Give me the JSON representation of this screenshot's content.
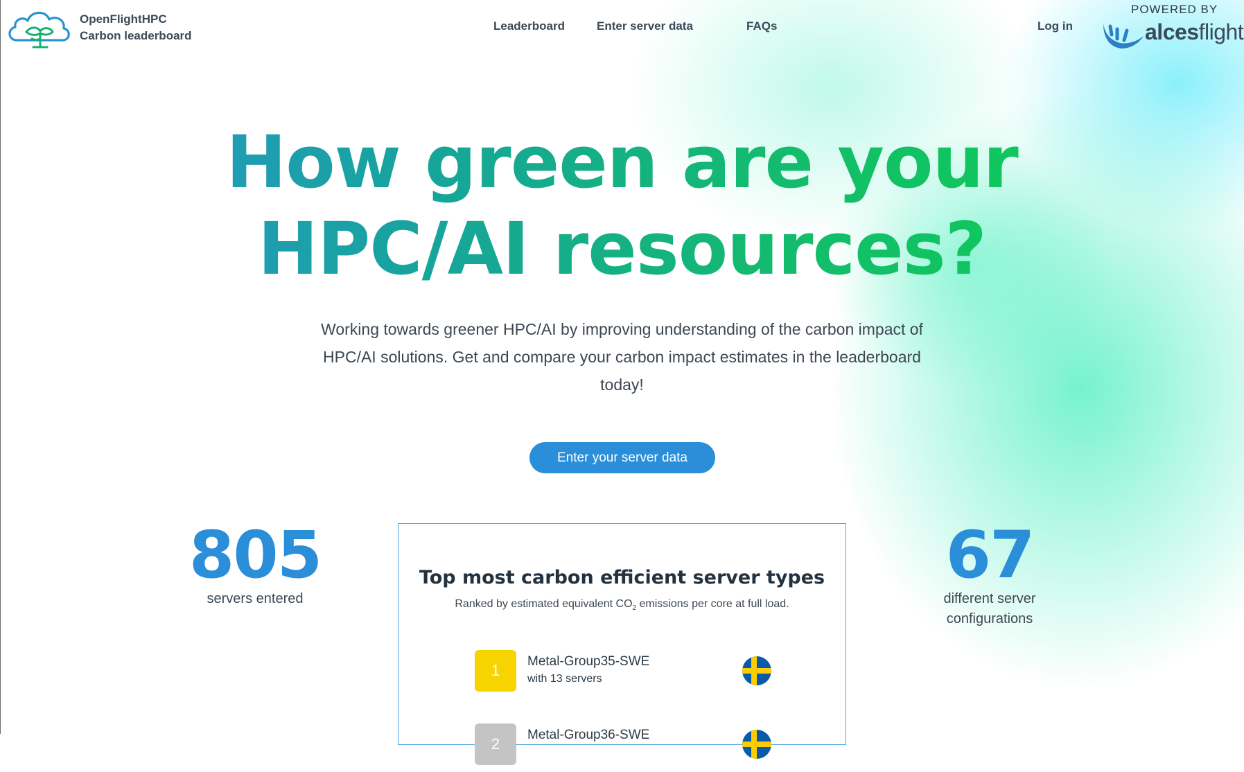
{
  "header": {
    "brand_line1": "OpenFlightHPC",
    "brand_line2": "Carbon leaderboard",
    "nav": [
      {
        "label": "Leaderboard"
      },
      {
        "label": "Enter server data"
      },
      {
        "label": "FAQs"
      }
    ],
    "login_label": "Log in",
    "powered_by": "POWERED BY",
    "partner_logo_bold": "alces",
    "partner_logo_light": "flight"
  },
  "hero": {
    "headline_line1": "How green are your",
    "headline_line2": "HPC/AI resources?",
    "intro": "Working towards greener HPC/AI by improving understanding of the carbon impact of HPC/AI solutions. Get and compare your carbon impact estimates in the leaderboard today!",
    "cta_label": "Enter your server data"
  },
  "stats": [
    {
      "value": "805",
      "label": "servers entered"
    },
    {
      "value": "67",
      "label": "different server configurations"
    }
  ],
  "top_list": {
    "title": "Top most carbon efficient server types",
    "subtitle_pre": "Ranked by estimated equivalent CO",
    "subtitle_sub": "2",
    "subtitle_post": " emissions per core at full load.",
    "items": [
      {
        "rank": "1",
        "name": "Metal-Group35-SWE",
        "count": "with 13 servers",
        "flag": "sweden-flag",
        "badge_color": "#f7d400"
      },
      {
        "rank": "2",
        "name": "Metal-Group36-SWE",
        "count": "",
        "flag": "sweden-flag",
        "badge_color": "#c4c4c4"
      }
    ]
  },
  "colors": {
    "accent_blue": "#2b8ed8",
    "accent_green": "#0ad34f",
    "card_border": "#4aa3dd",
    "gold": "#f7d400",
    "silver": "#c4c4c4"
  }
}
